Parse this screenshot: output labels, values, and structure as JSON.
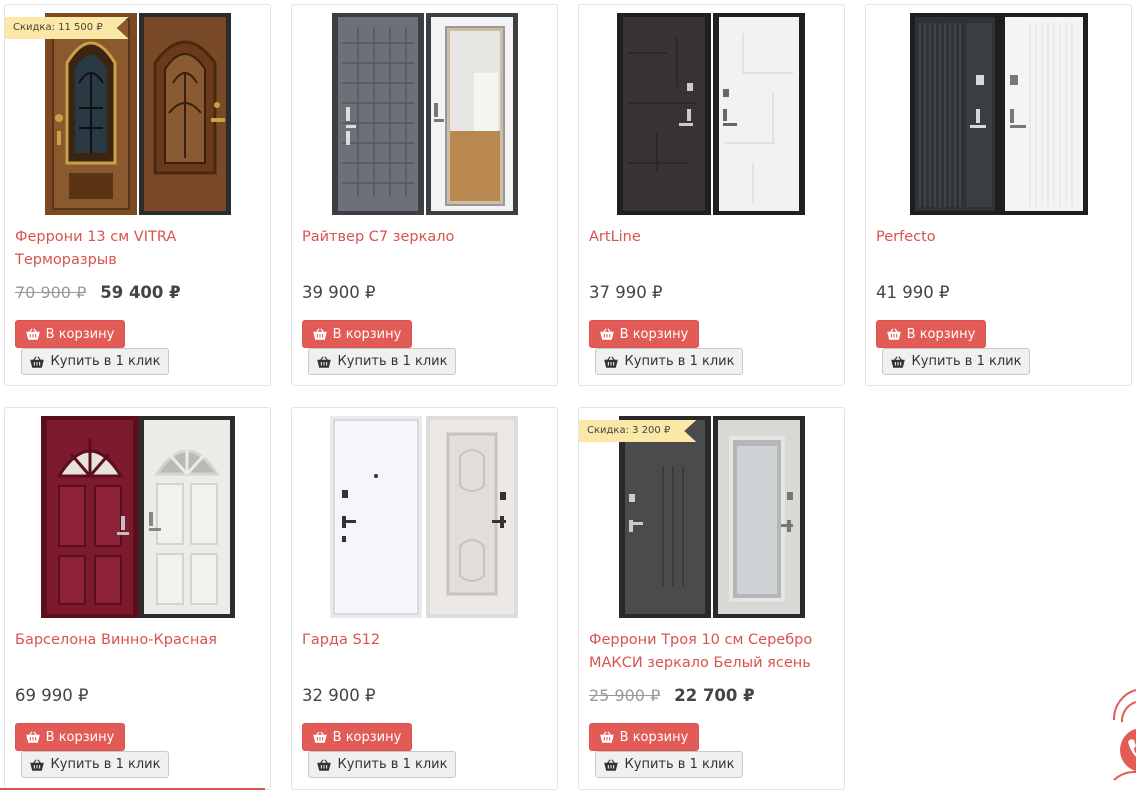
{
  "currency": "₽",
  "colors": {
    "accent": "#e35b57",
    "badge_bg": "#fbe7a6",
    "title": "#d9534f"
  },
  "products": [
    {
      "title": "Феррони 13 см VITRA Терморазрыв",
      "old_price": "70 900 ₽",
      "price": "59 400 ₽",
      "badge": "Скидка: 11 500 ₽",
      "cart_label": "В корзину",
      "oneclick_label": "Купить в 1 клик"
    },
    {
      "title": "Райтвер С7 зеркало",
      "price": "39 900 ₽",
      "cart_label": "В корзину",
      "oneclick_label": "Купить в 1 клик"
    },
    {
      "title": "ArtLine",
      "price": "37 990 ₽",
      "cart_label": "В корзину",
      "oneclick_label": "Купить в 1 клик"
    },
    {
      "title": "Perfecto",
      "price": "41 990 ₽",
      "cart_label": "В корзину",
      "oneclick_label": "Купить в 1 клик"
    },
    {
      "title": "Барселона Винно-Красная",
      "price": "69 990 ₽",
      "cart_label": "В корзину",
      "oneclick_label": "Купить в 1 клик"
    },
    {
      "title": "Гарда S12",
      "price": "32 900 ₽",
      "cart_label": "В корзину",
      "oneclick_label": "Купить в 1 клик"
    },
    {
      "title": "Феррони Троя 10 см Серебро МАКСИ зеркало Белый ясень",
      "old_price": "25 900 ₽",
      "price": "22 700 ₽",
      "badge": "Скидка: 3 200 ₽",
      "cart_label": "В корзину",
      "oneclick_label": "Купить в 1 клик"
    }
  ]
}
